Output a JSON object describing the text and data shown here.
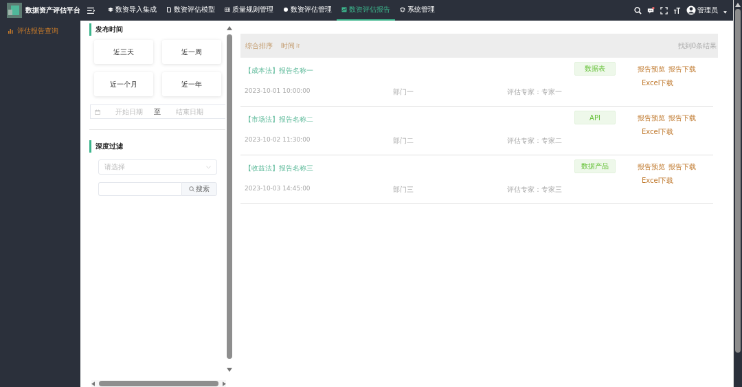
{
  "header": {
    "title": "数据资产评估平台",
    "nav": [
      {
        "label": "数资导入集成",
        "selected": false
      },
      {
        "label": "数资评估模型",
        "selected": false
      },
      {
        "label": "质量规则管理",
        "selected": false
      },
      {
        "label": "数资评估管理",
        "selected": false
      },
      {
        "label": "数资评估报告",
        "selected": true
      },
      {
        "label": "系统管理",
        "selected": false
      }
    ],
    "notification": true,
    "user": "管理员"
  },
  "sidebar": {
    "items": [
      {
        "label": "评估报告查询",
        "selected": true
      }
    ]
  },
  "filter": {
    "publish_title": "发布时间",
    "quick_ranges": [
      "近三天",
      "近一周",
      "近一个月",
      "近一年"
    ],
    "date_range": {
      "start_placeholder": "开始日期",
      "separator": "至",
      "end_placeholder": "结束日期"
    },
    "depth_title": "深度过滤",
    "select_placeholder": "请选择",
    "search_button": "搜索"
  },
  "results": {
    "sort_options": [
      "综合排序",
      "时间"
    ],
    "count": "找到0条结果",
    "items": [
      {
        "title": "【成本法】报告名称一",
        "time": "2023-10-01 10:00:00",
        "department": "部门一",
        "expert": "评估专家：专家一",
        "tag": "数据表",
        "actions": [
          "报告预览",
          "报告下载",
          "Excel下载"
        ]
      },
      {
        "title": "【市场法】报告名称二",
        "time": "2023-10-02 11:30:00",
        "department": "部门二",
        "expert": "评估专家：专家二",
        "tag": "API",
        "actions": [
          "报告预览",
          "报告下载",
          "Excel下载"
        ]
      },
      {
        "title": "【收益法】报告名称三",
        "time": "2023-10-03 14:45:00",
        "department": "部门三",
        "expert": "评估专家：专家三",
        "tag": "数据产品",
        "actions": [
          "报告预览",
          "报告下载",
          "Excel下载"
        ]
      }
    ]
  }
}
